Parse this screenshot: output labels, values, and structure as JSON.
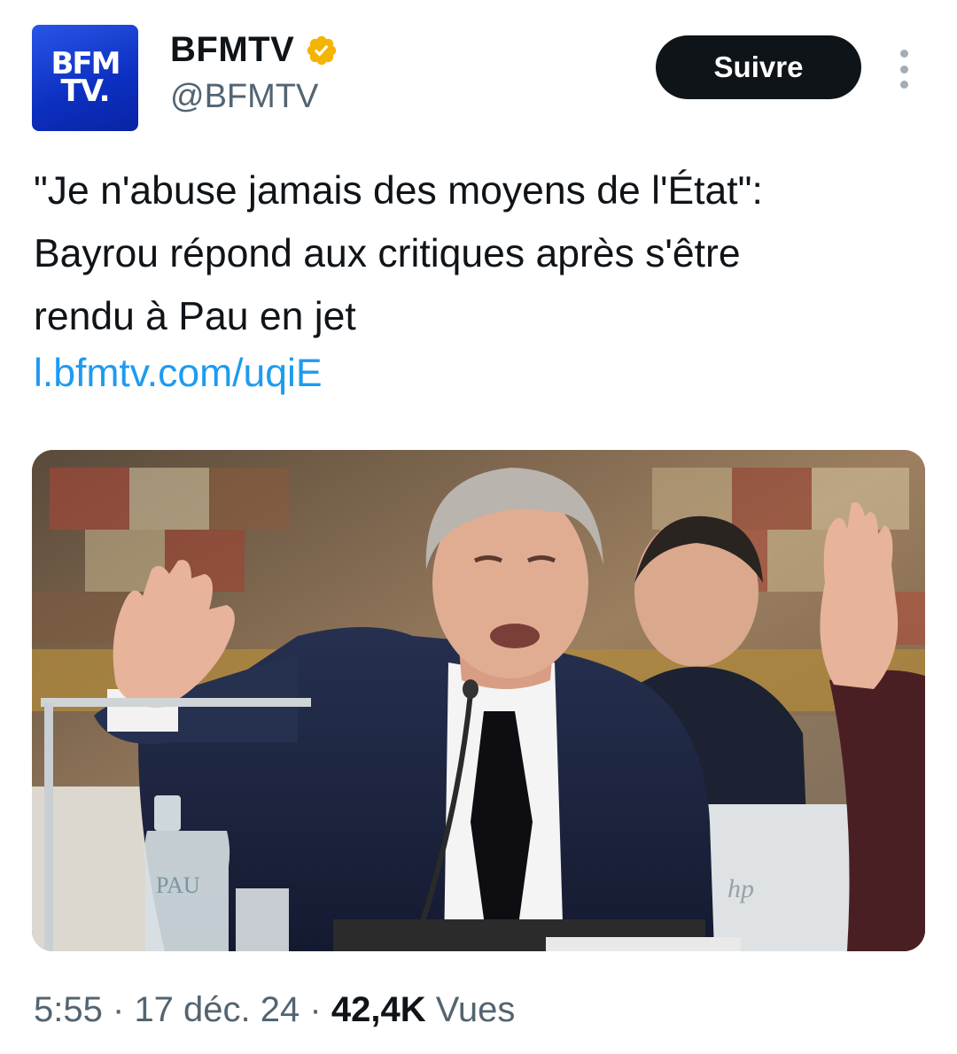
{
  "account": {
    "avatar_line1": "BFM",
    "avatar_line2": "TV.",
    "display_name": "BFMTV",
    "handle": "@BFMTV",
    "verified_color": "#f4b400",
    "brand_color": "#0c2fc0"
  },
  "follow_label": "Suivre",
  "more_icon": "more-vertical-icon",
  "tweet": {
    "lines": [
      "\"Je n'abuse jamais des moyens de l'État\":",
      "Bayrou répond aux critiques après s'être",
      "rendu à Pau en jet"
    ],
    "link": "l.bfmtv.com/uqiE",
    "link_color": "#1d9bf0"
  },
  "photo": {
    "bottle_label": "PAU",
    "laptop_brand": "hp"
  },
  "meta": {
    "time": "5:55",
    "separator": "·",
    "date": "17 déc. 24",
    "views_count": "42,4K",
    "views_label": "Vues"
  }
}
